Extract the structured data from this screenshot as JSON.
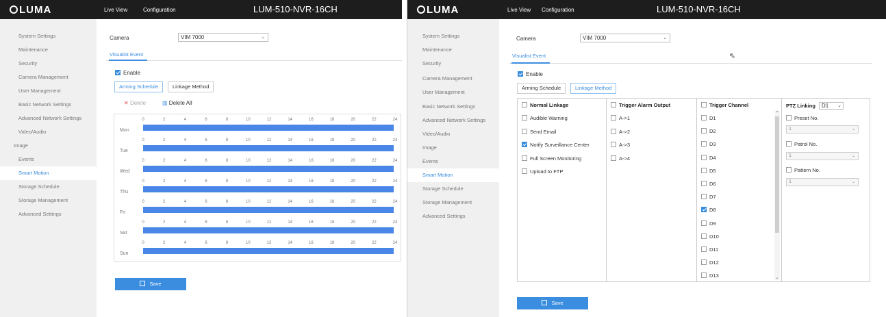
{
  "brand": "LUMA",
  "nav": {
    "live_view": "Live View",
    "configuration": "Configuration"
  },
  "device": "LUM-510-NVR-16CH",
  "sidebar": [
    "System Settings",
    "Maintenance",
    "Security",
    "Camera Management",
    "User Management",
    "Basic Network Settings",
    "Advanced Network Settings",
    "Video/Audio",
    "Image",
    "Events",
    "Smart Motion",
    "Storage Schedule",
    "Storage Management",
    "Advanced Settings"
  ],
  "sidebar_active": "Smart Motion",
  "camera": {
    "label": "Camera",
    "value": "VIM 7000"
  },
  "event_tab": "Visualist Event",
  "enable_label": "Enable",
  "subtabs": {
    "arming": "Arming Schedule",
    "linkage": "Linkage Method"
  },
  "toolbar": {
    "delete": "Delete",
    "delete_all": "Delete All"
  },
  "days": [
    "Mon",
    "Tue",
    "Wed",
    "Thu",
    "Fri",
    "Sat",
    "Sun"
  ],
  "hours": [
    "0",
    "2",
    "4",
    "6",
    "8",
    "10",
    "12",
    "14",
    "16",
    "18",
    "20",
    "22",
    "24"
  ],
  "save_label": "Save",
  "linkage": {
    "normal": {
      "header": "Normal Linkage",
      "items": [
        {
          "label": "Audible Warning",
          "checked": false
        },
        {
          "label": "Send Email",
          "checked": false
        },
        {
          "label": "Notify Surveillance Center",
          "checked": true
        },
        {
          "label": "Full Screen Monitoring",
          "checked": false
        },
        {
          "label": "Upload to FTP",
          "checked": false
        }
      ]
    },
    "alarm": {
      "header": "Trigger Alarm Output",
      "items": [
        "A->1",
        "A->2",
        "A->3",
        "A->4"
      ]
    },
    "channel": {
      "header": "Trigger Channel",
      "items": [
        "D1",
        "D2",
        "D3",
        "D4",
        "D5",
        "D6",
        "D7",
        "D8",
        "D9",
        "D10",
        "D11",
        "D12",
        "D13"
      ],
      "checked": "D8"
    },
    "ptz": {
      "header": "PTZ Linking",
      "select": "D1",
      "preset": "Preset No.",
      "patrol": "Patrol No.",
      "pattern": "Pattern No.",
      "placeholder": "1"
    }
  },
  "colors": {
    "accent": "#3b8de0",
    "topbar": "#1d1d1d",
    "schedule_bar": "#4a86e8"
  }
}
